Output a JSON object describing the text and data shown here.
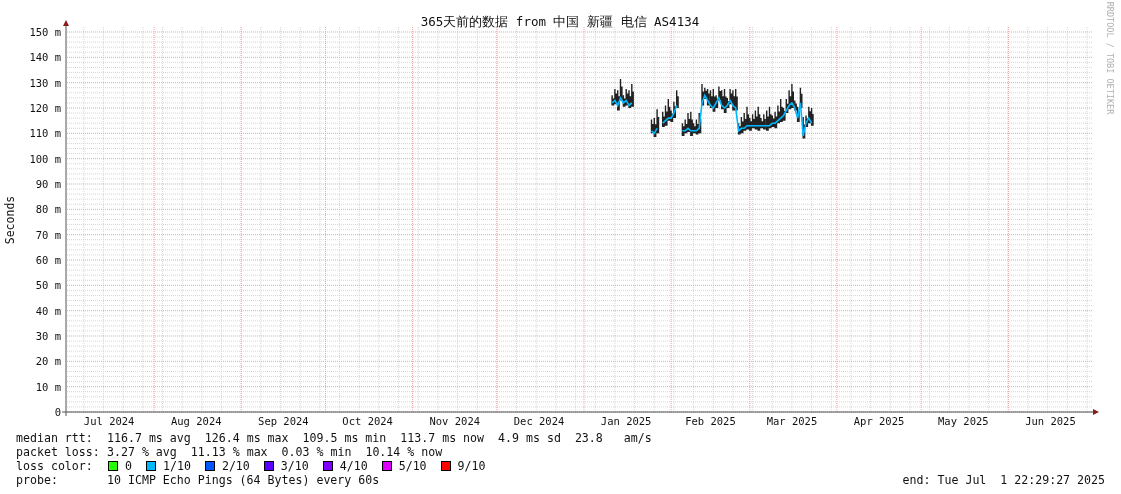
{
  "graph": {
    "title": "365天前的数据 from 中国 新疆 电信 AS4134",
    "credit": "RRDTOOL / TOBI OETIKER",
    "chart_data": {
      "type": "line",
      "grid": true,
      "ylabel": "Seconds",
      "xlim": [
        "2024-07-01",
        "2025-07-01"
      ],
      "ylim": [
        0,
        150
      ],
      "xticks": [
        {
          "value": "2024-07-16",
          "label": "Jul 2024"
        },
        {
          "value": "2024-08-16",
          "label": "Aug 2024"
        },
        {
          "value": "2024-09-16",
          "label": "Sep 2024"
        },
        {
          "value": "2024-10-16",
          "label": "Oct 2024"
        },
        {
          "value": "2024-11-16",
          "label": "Nov 2024"
        },
        {
          "value": "2024-12-16",
          "label": "Dec 2024"
        },
        {
          "value": "2025-01-16",
          "label": "Jan 2025"
        },
        {
          "value": "2025-02-15",
          "label": "Feb 2025"
        },
        {
          "value": "2025-03-16",
          "label": "Mar 2025"
        },
        {
          "value": "2025-04-16",
          "label": "Apr 2025"
        },
        {
          "value": "2025-05-16",
          "label": "May 2025"
        },
        {
          "value": "2025-06-16",
          "label": "Jun 2025"
        }
      ],
      "yticks": [
        {
          "value": 0,
          "label": "0"
        },
        {
          "value": 10,
          "label": "10 m"
        },
        {
          "value": 20,
          "label": "20 m"
        },
        {
          "value": 30,
          "label": "30 m"
        },
        {
          "value": 40,
          "label": "40 m"
        },
        {
          "value": 50,
          "label": "50 m"
        },
        {
          "value": 60,
          "label": "60 m"
        },
        {
          "value": 70,
          "label": "70 m"
        },
        {
          "value": 80,
          "label": "80 m"
        },
        {
          "value": 90,
          "label": "90 m"
        },
        {
          "value": 100,
          "label": "100 m"
        },
        {
          "value": 110,
          "label": "110 m"
        },
        {
          "value": 120,
          "label": "120 m"
        },
        {
          "value": 130,
          "label": "130 m"
        },
        {
          "value": 140,
          "label": "140 m"
        },
        {
          "value": 150,
          "label": "150 m"
        }
      ],
      "x": [
        "2025-01-11",
        "2025-01-12",
        "2025-01-13",
        "2025-01-14",
        "2025-01-15",
        "2025-01-16",
        "2025-01-17",
        "2025-01-18",
        "2025-01-19",
        "2025-01-25",
        "2025-01-26",
        "2025-01-27",
        "2025-01-28",
        "2025-01-29",
        "2025-01-30",
        "2025-01-31",
        "2025-02-01",
        "2025-02-02",
        "2025-02-03",
        "2025-02-04",
        "2025-02-05",
        "2025-02-06",
        "2025-02-07",
        "2025-02-08",
        "2025-02-09",
        "2025-02-10",
        "2025-02-11",
        "2025-02-12",
        "2025-02-13",
        "2025-02-14",
        "2025-02-15",
        "2025-02-16",
        "2025-02-17",
        "2025-02-18",
        "2025-02-19",
        "2025-02-20",
        "2025-02-21",
        "2025-02-22",
        "2025-02-23",
        "2025-02-24",
        "2025-02-25",
        "2025-02-26",
        "2025-02-27",
        "2025-02-28",
        "2025-03-01",
        "2025-03-02",
        "2025-03-03",
        "2025-03-04",
        "2025-03-05",
        "2025-03-06",
        "2025-03-07",
        "2025-03-08",
        "2025-03-09",
        "2025-03-10",
        "2025-03-11",
        "2025-03-12",
        "2025-03-13",
        "2025-03-14",
        "2025-03-15",
        "2025-03-16",
        "2025-03-17",
        "2025-03-18",
        "2025-03-19",
        "2025-03-20",
        "2025-03-21",
        "2025-03-22",
        "2025-03-23"
      ],
      "series": [
        {
          "color": "#00b8ff",
          "values": [
            122,
            123,
            121,
            124,
            122,
            123,
            121,
            122,
            null,
            111,
            110,
            112,
            null,
            114,
            115,
            116,
            116,
            118,
            121,
            null,
            111,
            111,
            112,
            111,
            111,
            111,
            112,
            122,
            125,
            123,
            121,
            120,
            122,
            124,
            121,
            120,
            121,
            123,
            121,
            120,
            111,
            112,
            112,
            113,
            113,
            113,
            113,
            113,
            113,
            113,
            113,
            113,
            114,
            114,
            115,
            116,
            117,
            119,
            121,
            122,
            120,
            116,
            122,
            109,
            114,
            116,
            114
          ]
        }
      ]
    }
  },
  "legend": {
    "stats": [
      {
        "label": "median rtt:",
        "values": [
          "116.7 ms avg",
          "126.4 ms max",
          "109.5 ms min",
          "113.7 ms now",
          "4.9 ms sd",
          "23.8   am/s"
        ]
      },
      {
        "label": "packet loss:",
        "values": [
          "3.27 % avg",
          "11.13 % max",
          "0.03 % min",
          "10.14 % now"
        ]
      }
    ],
    "loss_colors": {
      "label": "loss color:",
      "items": [
        {
          "label": "0",
          "color": "#26ff00"
        },
        {
          "label": "1/10",
          "color": "#00b8ff"
        },
        {
          "label": "2/10",
          "color": "#0059ff"
        },
        {
          "label": "3/10",
          "color": "#5e00ff"
        },
        {
          "label": "4/10",
          "color": "#7e00ff"
        },
        {
          "label": "5/10",
          "color": "#dd00ff"
        },
        {
          "label": "9/10",
          "color": "#ff0000"
        }
      ]
    },
    "probe": {
      "label": "probe:",
      "value": "10 ICMP Echo Pings (64 Bytes) every 60s"
    },
    "end": "end: Tue Jul  1 22:29:27 2025"
  }
}
